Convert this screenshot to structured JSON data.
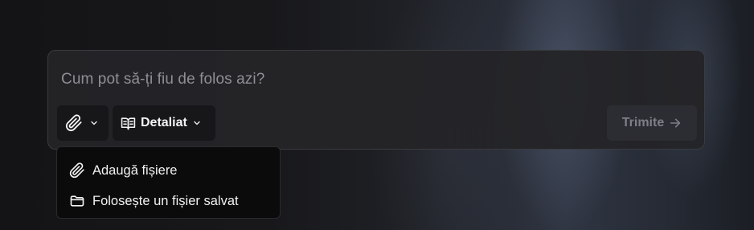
{
  "composer": {
    "placeholder": "Cum pot să-ți fiu de folos azi?",
    "attach": {
      "icon": "paperclip-icon",
      "chevron": "chevron-down-icon"
    },
    "mode": {
      "icon": "book-open-icon",
      "label": "Detaliat",
      "chevron": "chevron-down-icon"
    },
    "send": {
      "label": "Trimite",
      "icon": "arrow-right-icon",
      "enabled": false
    }
  },
  "attach_menu": {
    "items": [
      {
        "icon": "paperclip-icon",
        "label": "Adaugă fișiere"
      },
      {
        "icon": "folder-icon",
        "label": "Folosește un fișier salvat"
      }
    ]
  },
  "colors": {
    "composer_bg": "#242428",
    "button_bg": "#17171a",
    "menu_bg": "#0b0b0c",
    "placeholder_text": "#8e8e94",
    "disabled_text": "#7d7f88"
  }
}
